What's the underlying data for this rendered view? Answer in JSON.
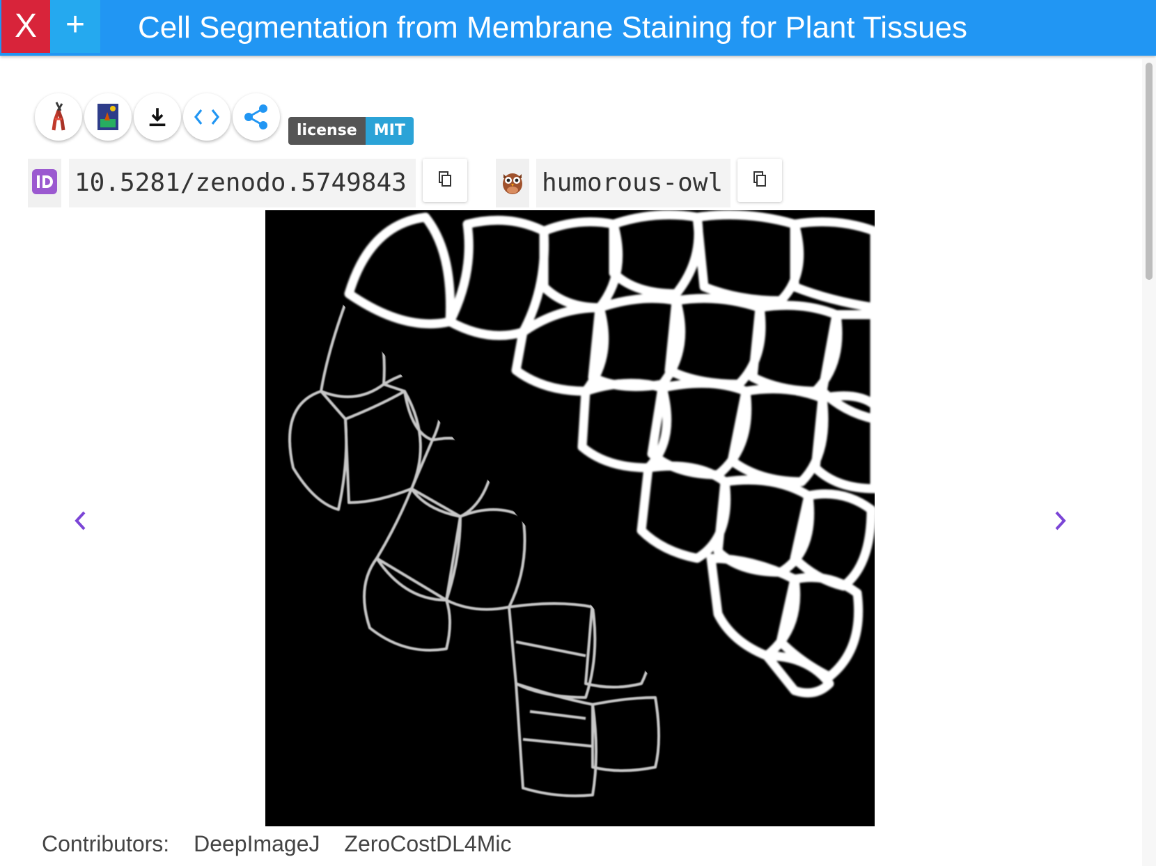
{
  "header": {
    "close_label": "X",
    "add_label": "+",
    "title": "Cell Segmentation from Membrane Staining for Plant Tissues",
    "color": "#2196f3"
  },
  "toolbar": {
    "buttons": [
      {
        "name": "bioimage-model-zoo-icon"
      },
      {
        "name": "app-preview-icon"
      },
      {
        "name": "download-icon"
      },
      {
        "name": "code-icon"
      },
      {
        "name": "share-icon"
      }
    ],
    "license_key": "license",
    "license_value": "MIT"
  },
  "ids": {
    "doi": "10.5281/zenodo.5749843",
    "nickname": "humorous-owl",
    "nickname_icon": "owl-icon"
  },
  "carousel": {
    "prev_icon": "chevron-left-icon",
    "next_icon": "chevron-right-icon",
    "accent": "#7b45d6"
  },
  "footer": {
    "contributors_label": "Contributors:",
    "contributors": [
      "DeepImageJ",
      "ZeroCostDL4Mic"
    ]
  }
}
